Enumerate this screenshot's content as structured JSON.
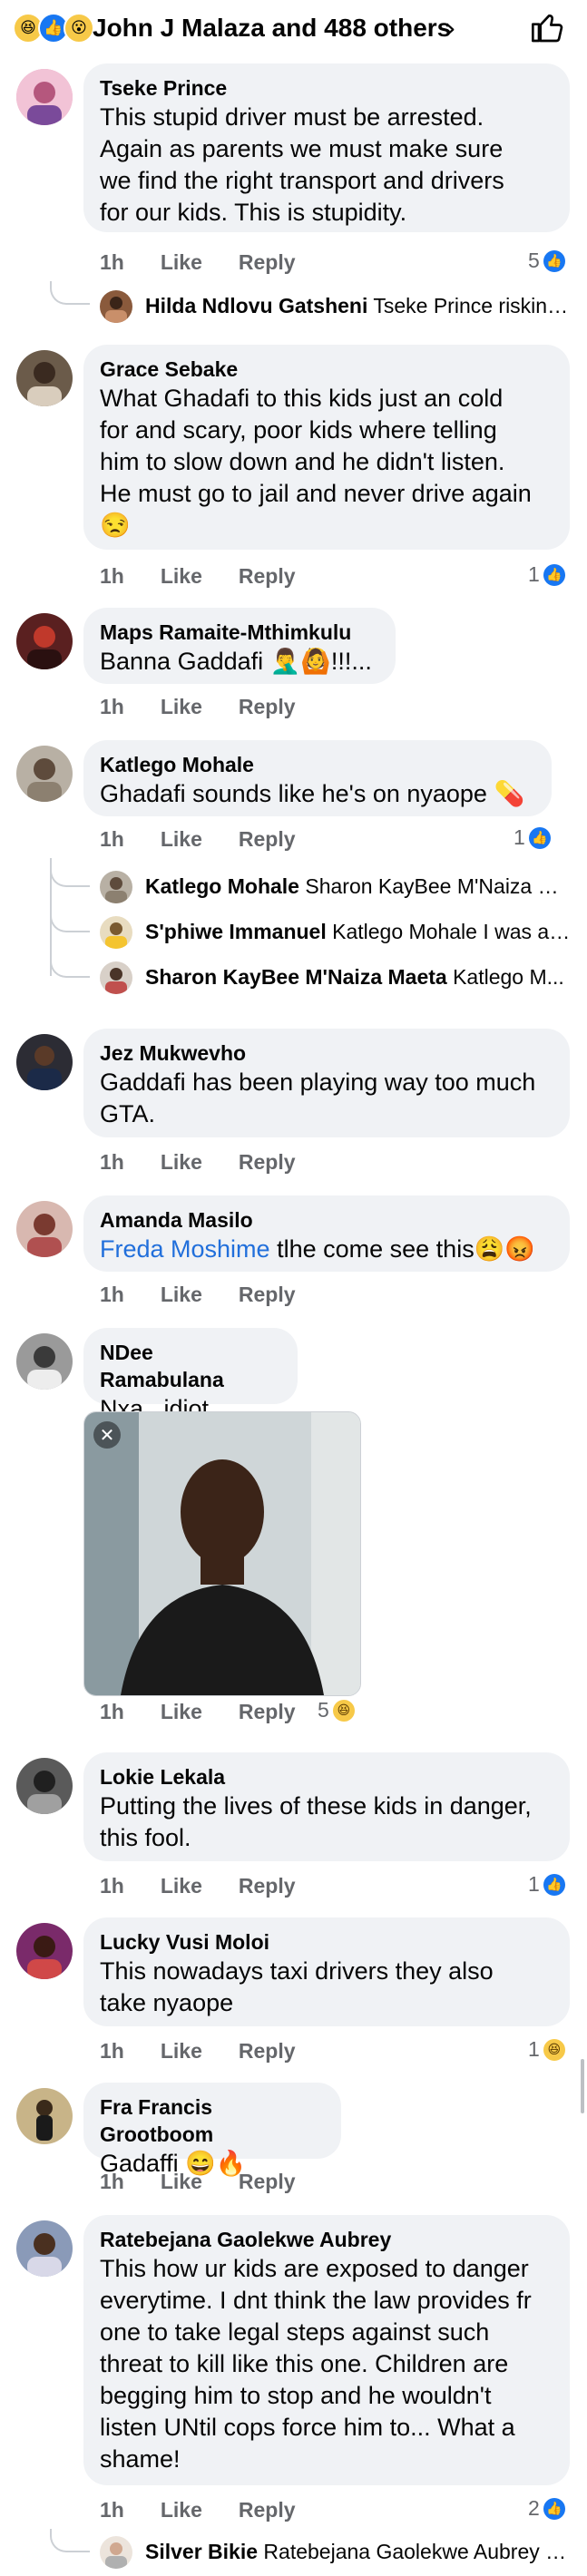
{
  "header": {
    "reaction_icons": [
      "haha",
      "like",
      "wow"
    ],
    "title": "John J Malaza and 488 others",
    "chevron": "›",
    "like_icon": "thumbs-up-outline-icon"
  },
  "labels": {
    "time": "1h",
    "like": "Like",
    "reply": "Reply"
  },
  "comments": [
    {
      "name": "Tseke Prince",
      "text": "This stupid driver must be arrested.\nAgain as parents we must make sure\nwe find the right transport and drivers\nfor our kids. This is stupidity.",
      "count": "5",
      "reaction": "like",
      "replies": [
        {
          "name": "Hilda Ndlovu Gatsheni",
          "text": "Tseke Prince risking..."
        }
      ]
    },
    {
      "name": "Grace Sebake",
      "text": "What Ghadafi to this kids just an cold\nfor and scary, poor kids where telling\nhim to slow down and he didn't listen.\nHe must go to jail and never drive again\n😒",
      "count": "1",
      "reaction": "like"
    },
    {
      "name": "Maps Ramaite-Mthimkulu",
      "text": "Banna Gaddafi 🤦‍♂️🙆!!!..."
    },
    {
      "name": "Katlego Mohale",
      "text": "Ghadafi sounds like he's on nyaope 💊",
      "count": "1",
      "reaction": "like",
      "replies": [
        {
          "name": "Katlego Mohale",
          "text": "Sharon KayBee M'Naiza Ma..."
        },
        {
          "name": "S'phiwe Immanuel",
          "text": "Katlego Mohale I was ab..."
        },
        {
          "name": "Sharon KayBee M'Naiza Maeta",
          "text": "Katlego M..."
        }
      ]
    },
    {
      "name": "Jez Mukwevho",
      "text": "Gaddafi has been playing way too much\nGTA."
    },
    {
      "name": "Amanda Masilo",
      "mention": "Freda Moshime",
      "text": " tlhe come see this😩😡"
    },
    {
      "name": "NDee Ramabulana",
      "text": "Nxa...idiot",
      "count": "5",
      "reaction": "haha",
      "photo_close": "✕"
    },
    {
      "name": "Lokie Lekala",
      "text": "Putting the lives of these kids in danger,\nthis fool.",
      "count": "1",
      "reaction": "like"
    },
    {
      "name": "Lucky Vusi Moloi",
      "text": "This nowadays taxi drivers they also\ntake nyaope",
      "count": "1",
      "reaction": "haha"
    },
    {
      "name": "Fra Francis Grootboom",
      "text": "Gadaffi 😄🔥"
    },
    {
      "name": "Ratebejana Gaolekwe Aubrey",
      "text": "This how ur kids are exposed to danger\neverytime. I dnt think the law provides fr\none to take legal steps against such\nthreat to kill like this one. Children are\nbegging him to stop and he wouldn't\nlisten UNtil cops force him to... What a\nshame!",
      "count": "2",
      "reaction": "like",
      "replies": [
        {
          "name": "Silver Bikie",
          "text": "Ratebejana Gaolekwe Aubrey Ei..."
        }
      ]
    }
  ],
  "colors": {
    "like_blue": "#1877f2",
    "bubble_bg": "#f0f2f5",
    "muted_text": "#65676b",
    "mention": "#216fdb",
    "haha_yellow": "#f7c948"
  }
}
